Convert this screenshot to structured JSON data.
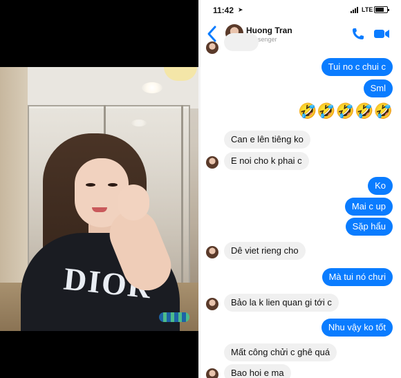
{
  "status_bar": {
    "time": "11:42",
    "location_icon": "location-arrow-icon",
    "network": "LTE",
    "battery_level": 0.75
  },
  "header": {
    "back_icon": "chevron-left-icon",
    "contact_name": "Huong Tran",
    "contact_subtitle": "Messenger",
    "call_icon": "phone-icon",
    "video_icon": "video-camera-icon",
    "accent_color": "#0a7cff"
  },
  "messages": [
    {
      "direction": "out",
      "text": "Tui no c chui c"
    },
    {
      "direction": "out",
      "text": "Sml"
    },
    {
      "direction": "out",
      "text": "🤣🤣🤣🤣🤣"
    },
    {
      "direction": "in",
      "text": "Can e lên tiêng ko"
    },
    {
      "direction": "in",
      "text": "E noi cho k phai c"
    },
    {
      "direction": "out",
      "text": "Ko"
    },
    {
      "direction": "out",
      "text": "Mai c up"
    },
    {
      "direction": "out",
      "text": "Sặp hẩu"
    },
    {
      "direction": "in",
      "text": "Dê viet rieng cho"
    },
    {
      "direction": "out",
      "text": "Mà tui nó chưi"
    },
    {
      "direction": "in",
      "text": "Bảo la k lien quan gi tới c"
    },
    {
      "direction": "out",
      "text": "Nhu vậy ko tốt"
    },
    {
      "direction": "in",
      "text": "Mất công chửi c ghê quá"
    },
    {
      "direction": "in",
      "text": "Bao hoi e ma"
    }
  ],
  "photo": {
    "shirt_text": "DIOR"
  }
}
